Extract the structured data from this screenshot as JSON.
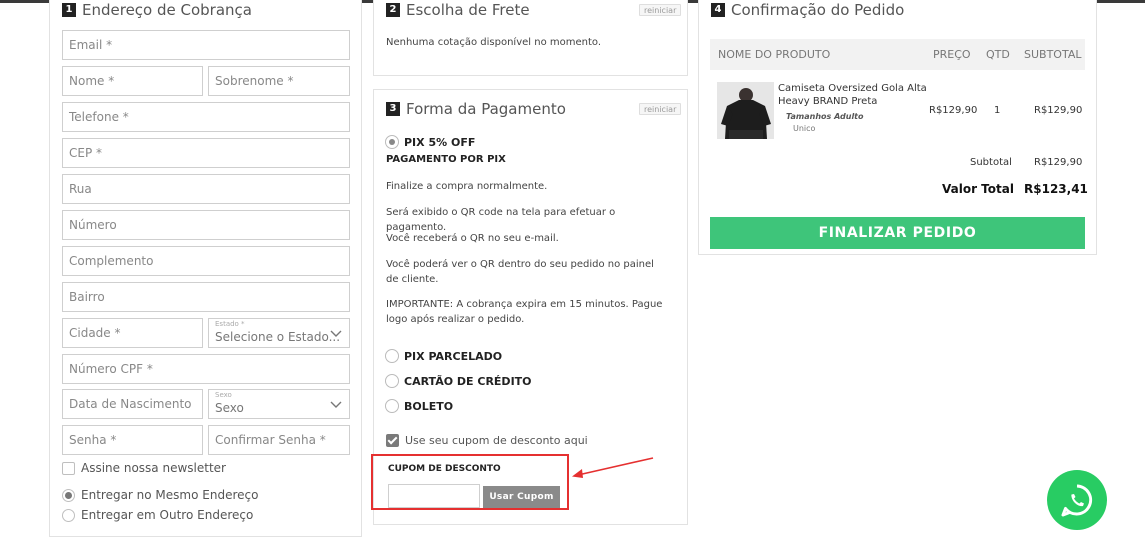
{
  "billing": {
    "step": "1",
    "title": "Endereço de Cobrança",
    "fields": {
      "email": "Email *",
      "first_name": "Nome *",
      "last_name": "Sobrenome *",
      "phone": "Telefone *",
      "cep": "CEP *",
      "street": "Rua",
      "number": "Número",
      "complement": "Complemento",
      "neighborhood": "Bairro",
      "city": "Cidade *",
      "state_label": "Estado *",
      "state_value": "Selecione o Estado...",
      "cpf": "Número CPF *",
      "birthdate": "Data de Nascimento",
      "sex_label": "Sexo",
      "sex_value": "Sexo",
      "password": "Senha *",
      "confirm_password": "Confirmar Senha *"
    },
    "newsletter": "Assine nossa newsletter",
    "delivery_same": "Entregar no Mesmo Endereço",
    "delivery_other": "Entregar em Outro Endereço"
  },
  "shipping": {
    "step": "2",
    "title": "Escolha de Frete",
    "reset": "reiniciar",
    "message": "Nenhuma cotação disponível no momento."
  },
  "payment": {
    "step": "3",
    "title": "Forma da Pagamento",
    "reset": "reiniciar",
    "selected_option": "PIX 5% OFF",
    "subtitle": "PAGAMENTO POR PIX",
    "instructions": [
      "Finalize a compra normalmente.",
      "Será exibido o QR code na tela para efetuar o pagamento.",
      "Você receberá o QR no seu e-mail.",
      "Você poderá ver o QR dentro do seu pedido no painel de cliente.",
      "IMPORTANTE: A cobrança expira em 15 minutos. Pague logo após realizar o pedido."
    ],
    "options": [
      "PIX PARCELADO",
      "CARTÃO DE CRÉDITO",
      "BOLETO"
    ],
    "use_coupon": "Use seu cupom de desconto aqui",
    "coupon_label": "CUPOM DE DESCONTO",
    "coupon_placeholder": "",
    "coupon_button": "Usar Cupom"
  },
  "order": {
    "step": "4",
    "title": "Confirmação do Pedido",
    "headers": {
      "product": "NOME DO PRODUTO",
      "price": "PREÇO",
      "qty": "QTD",
      "subtotal": "SUBTOTAL"
    },
    "item": {
      "name_line1": "Camiseta Oversized Gola Alta",
      "name_line2": "Heavy BRAND Preta",
      "variant_label": "Tamanhos Adulto",
      "variant_value": "Unico",
      "price": "R$129,90",
      "qty": "1",
      "subtotal": "R$129,90"
    },
    "subtotal_label": "Subtotal",
    "subtotal_value": "R$129,90",
    "total_label": "Valor Total",
    "total_value": "R$123,41",
    "finalize_button": "FINALIZAR PEDIDO"
  },
  "icons": {
    "whatsapp": "whatsapp-icon",
    "annotation": "red-arrow-annotation"
  },
  "colors": {
    "finalize": "#3ec57a",
    "whatsapp": "#28cc63",
    "highlight": "#e53030"
  }
}
